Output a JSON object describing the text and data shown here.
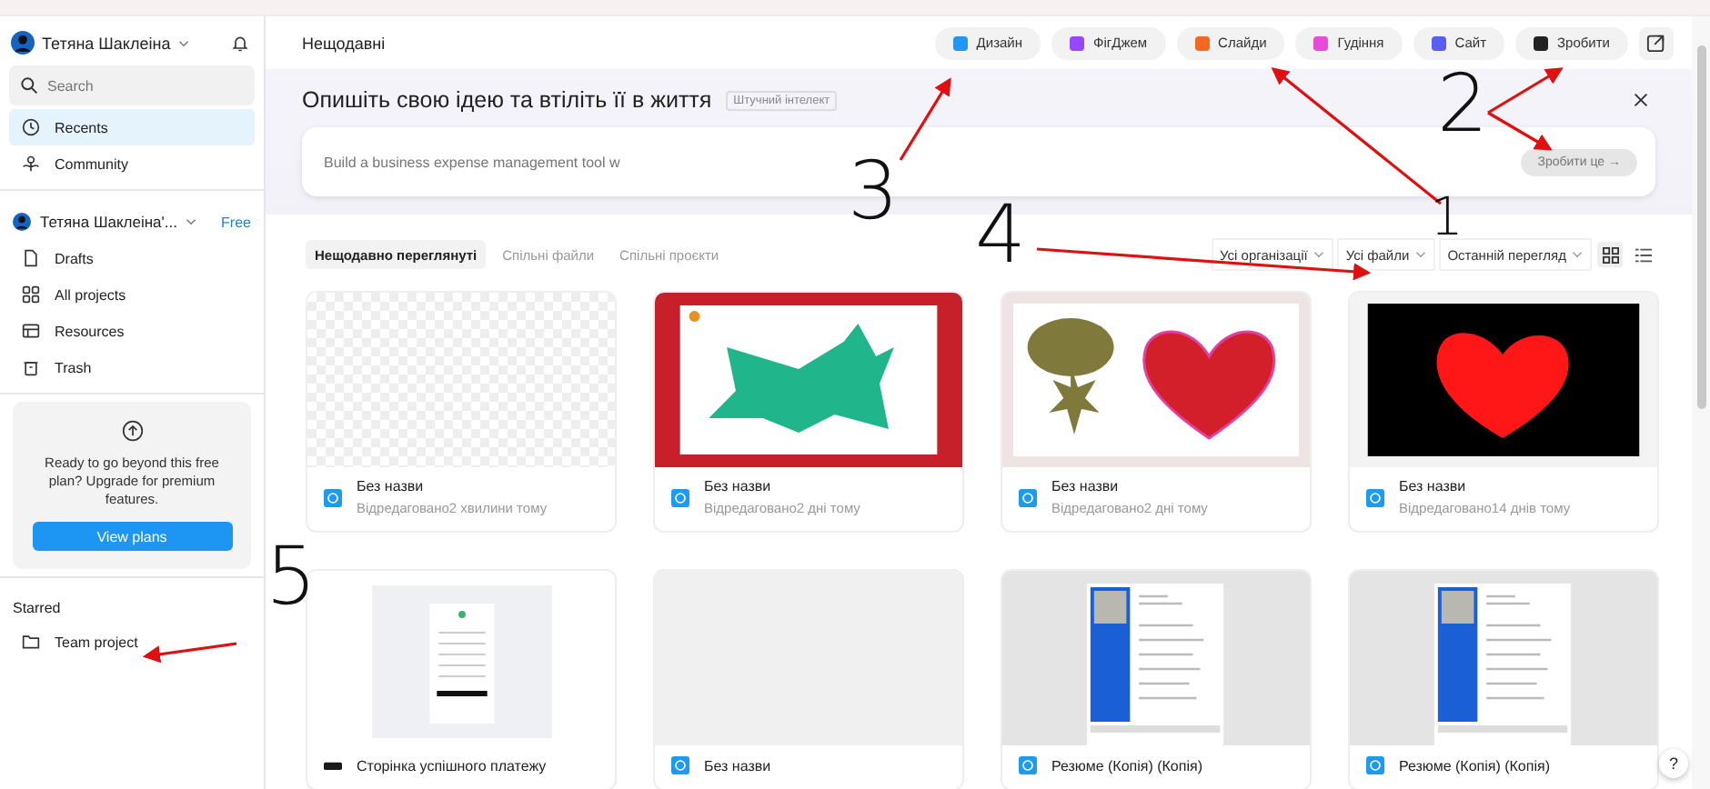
{
  "sidebar": {
    "user": {
      "name": "Тетяна Шаклеіна"
    },
    "search": {
      "placeholder": "Search"
    },
    "nav": [
      {
        "label": "Recents",
        "selected": true
      },
      {
        "label": "Community",
        "selected": false
      }
    ],
    "team": {
      "name": "Тетяна Шаклеіна'...",
      "badge": "Free"
    },
    "team_nav": [
      {
        "label": "Drafts",
        "selected": false
      },
      {
        "label": "All projects",
        "selected": false
      },
      {
        "label": "Resources",
        "selected": false
      },
      {
        "label": "Trash",
        "selected": false
      }
    ],
    "promo": {
      "text": "Ready to go beyond this free plan? Upgrade for premium features.",
      "button": "View plans"
    },
    "starred": {
      "heading": "Starred",
      "items": [
        {
          "label": "Team project"
        }
      ]
    }
  },
  "header": {
    "title": "Нещодавні",
    "actions": [
      {
        "label": "Дизайн",
        "color": "#2196f3"
      },
      {
        "label": "ФігДжем",
        "color": "#9747ff"
      },
      {
        "label": "Слайди",
        "color": "#f26722"
      },
      {
        "label": "Гудіння",
        "color": "#e84bd6"
      },
      {
        "label": "Сайт",
        "color": "#5a5df0"
      },
      {
        "label": "Зробити",
        "color": "#222222"
      }
    ]
  },
  "hero": {
    "title": "Опишіть свою ідею та втіліть її в життя",
    "tag": "Штучний інтелект",
    "placeholder": "Build a business expense management tool w",
    "submit": "Зробити це →",
    "disabled": true
  },
  "filters": {
    "tabs": [
      {
        "label": "Нещодавно переглянуті",
        "selected": true
      },
      {
        "label": "Спільні файли",
        "selected": false
      },
      {
        "label": "Спільні проєкти",
        "selected": false
      }
    ],
    "dropdowns": [
      "Усі організації",
      "Усі файли",
      "Останній перегляд"
    ],
    "views": [
      {
        "kind": "grid",
        "selected": true
      },
      {
        "kind": "list",
        "selected": false
      }
    ]
  },
  "files": [
    {
      "name": "Без назви",
      "edited": "Відредаговано2 хвилини тому",
      "kind": "blank"
    },
    {
      "name": "Без назви",
      "edited": "Відредаговано2 дні тому",
      "kind": "blob"
    },
    {
      "name": "Без назви",
      "edited": "Відредаговано2 дні тому",
      "kind": "shapes"
    },
    {
      "name": "Без назви",
      "edited": "Відредаговано14 днів тому",
      "kind": "heart"
    },
    {
      "name": "Сторінка успішного платежу",
      "kind": "receipt"
    },
    {
      "name": "Без назви",
      "kind": "empty"
    },
    {
      "name": "Резюме (Копія) (Копія)",
      "kind": "resume"
    },
    {
      "name": "Резюме (Копія) (Копія)",
      "kind": "resume"
    }
  ],
  "help": "?",
  "annotations": [
    {
      "label": "3"
    },
    {
      "label": "4"
    },
    {
      "label": "1"
    },
    {
      "label": "2"
    },
    {
      "label": "5"
    }
  ]
}
